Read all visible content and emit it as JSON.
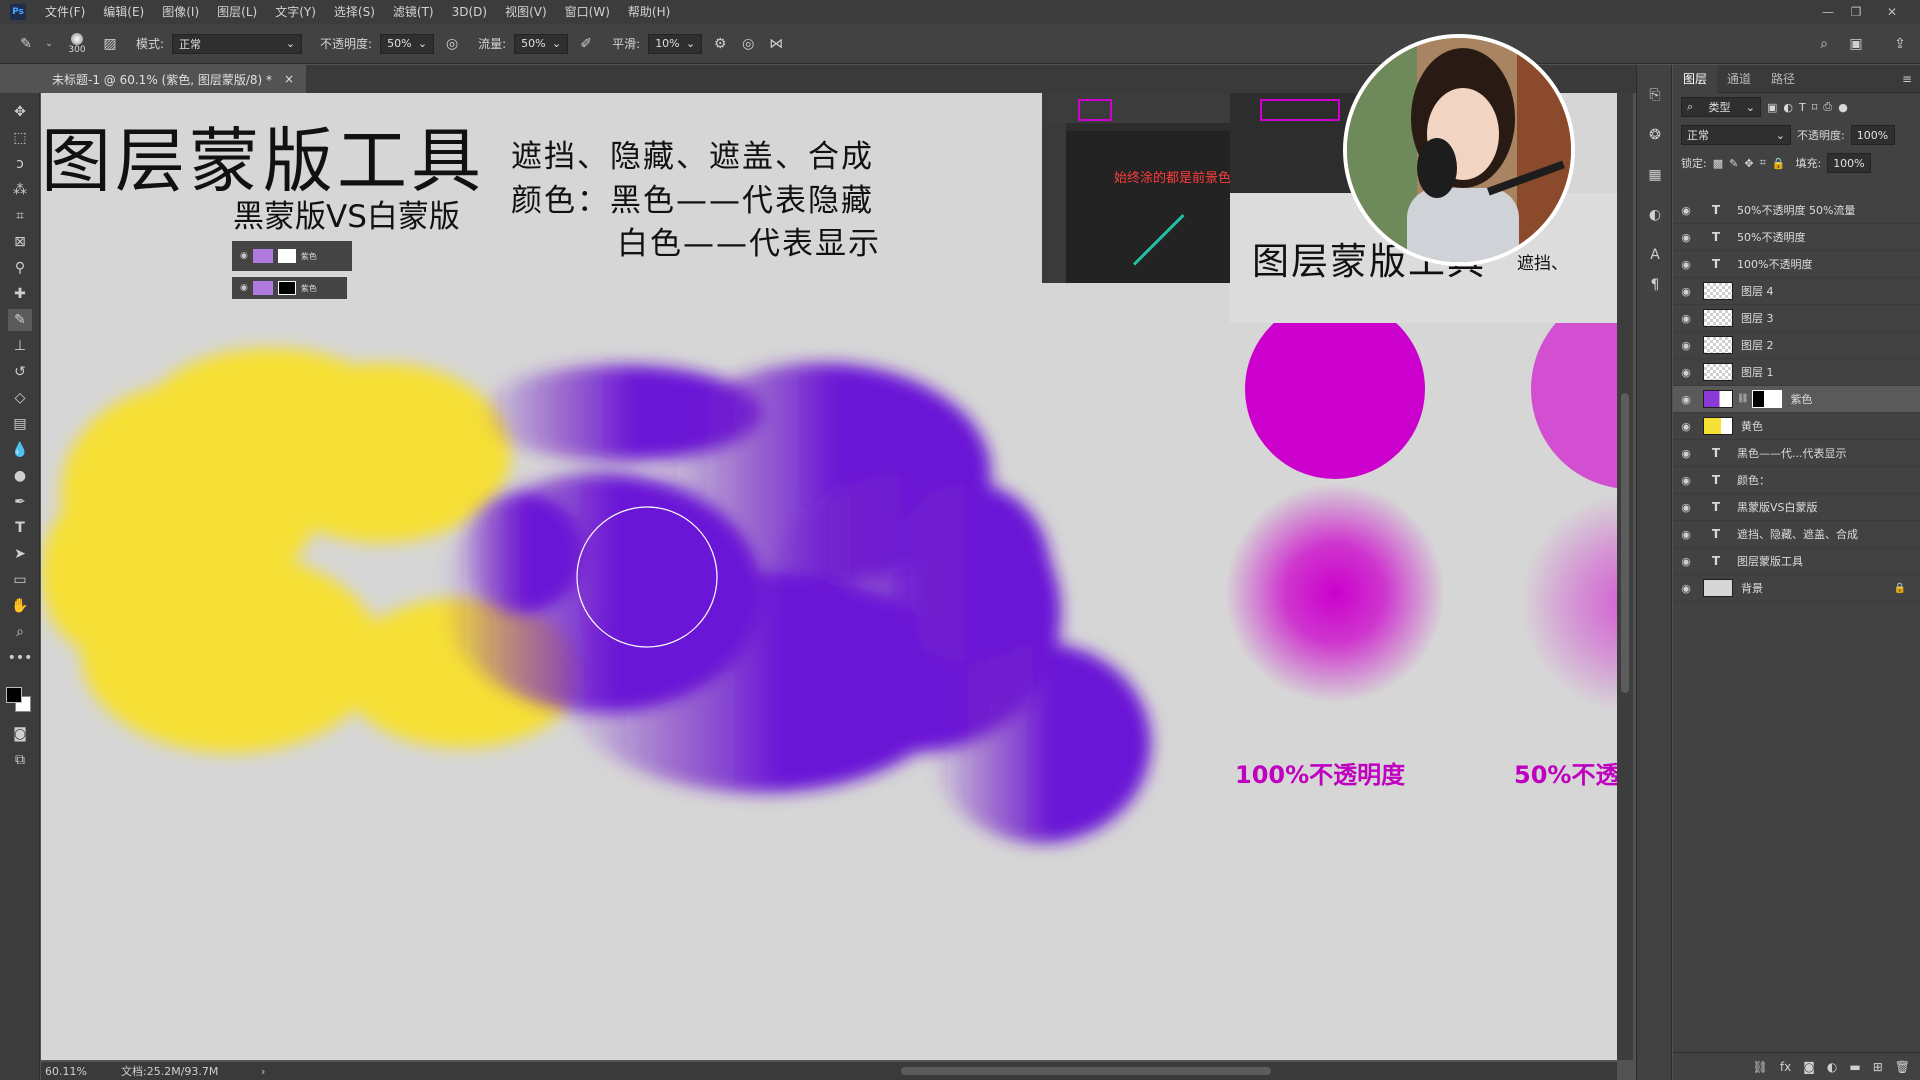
{
  "menubar": {
    "logo": "Ps",
    "items": [
      "文件(F)",
      "编辑(E)",
      "图像(I)",
      "图层(L)",
      "文字(Y)",
      "选择(S)",
      "滤镜(T)",
      "3D(D)",
      "视图(V)",
      "窗口(W)",
      "帮助(H)"
    ]
  },
  "options": {
    "brush_size": "300",
    "mode_label": "模式:",
    "mode_value": "正常",
    "opacity_label": "不透明度:",
    "opacity_value": "50%",
    "flow_label": "流量:",
    "flow_value": "50%",
    "smooth_label": "平滑:",
    "smooth_value": "10%"
  },
  "document_tab": {
    "title": "未标题-1 @ 60.1% (紫色, 图层蒙版/8) *",
    "close": "×"
  },
  "canvas": {
    "title": "图层蒙版工具",
    "subtitle": "黑蒙版VS白蒙版",
    "line1": "遮挡、隐藏、遮盖、合成",
    "line2": "颜色：黑色——代表隐藏",
    "line3": "白色——代表显示",
    "mini_layer_label": "紫色",
    "screenshot_note": "始终涂的都是前景色",
    "screenshot_title": "图层蒙版工具",
    "screenshot_sub": "遮挡、",
    "label_100": "100%不透明度",
    "label_50": "50%不透",
    "colors": {
      "yellow": "#f6e034",
      "purple": "#6a14d6",
      "magenta": "#cc00cc",
      "pink": "#d24fd2",
      "canvas_bg": "#d6d6d6"
    }
  },
  "status": {
    "zoom": "60.11%",
    "doc": "文档:25.2M/93.7M",
    "arrow": "›"
  },
  "layers_panel": {
    "tabs": [
      "图层",
      "通道",
      "路径"
    ],
    "filter_label": "类型",
    "blend_mode": "正常",
    "opacity_label": "不透明度:",
    "opacity_value": "100%",
    "lock_label": "锁定:",
    "fill_label": "填充:",
    "fill_value": "100%",
    "layers": [
      {
        "type": "T",
        "name": "50%不透明度 50%流量"
      },
      {
        "type": "T",
        "name": "50%不透明度"
      },
      {
        "type": "T",
        "name": "100%不透明度"
      },
      {
        "type": "pixel",
        "name": "图层 4"
      },
      {
        "type": "pixel",
        "name": "图层 3"
      },
      {
        "type": "pixel",
        "name": "图层 2"
      },
      {
        "type": "pixel",
        "name": "图层 1"
      },
      {
        "type": "masked",
        "name": "紫色",
        "selected": true
      },
      {
        "type": "pixel",
        "name": "黄色"
      },
      {
        "type": "T",
        "name": "黑色——代...代表显示"
      },
      {
        "type": "T",
        "name": "颜色："
      },
      {
        "type": "T",
        "name": "黑蒙版VS白蒙版"
      },
      {
        "type": "T",
        "name": "遮挡、隐藏、遮盖、合成"
      },
      {
        "type": "T",
        "name": "图层蒙版工具"
      },
      {
        "type": "bg",
        "name": "背景"
      }
    ]
  }
}
